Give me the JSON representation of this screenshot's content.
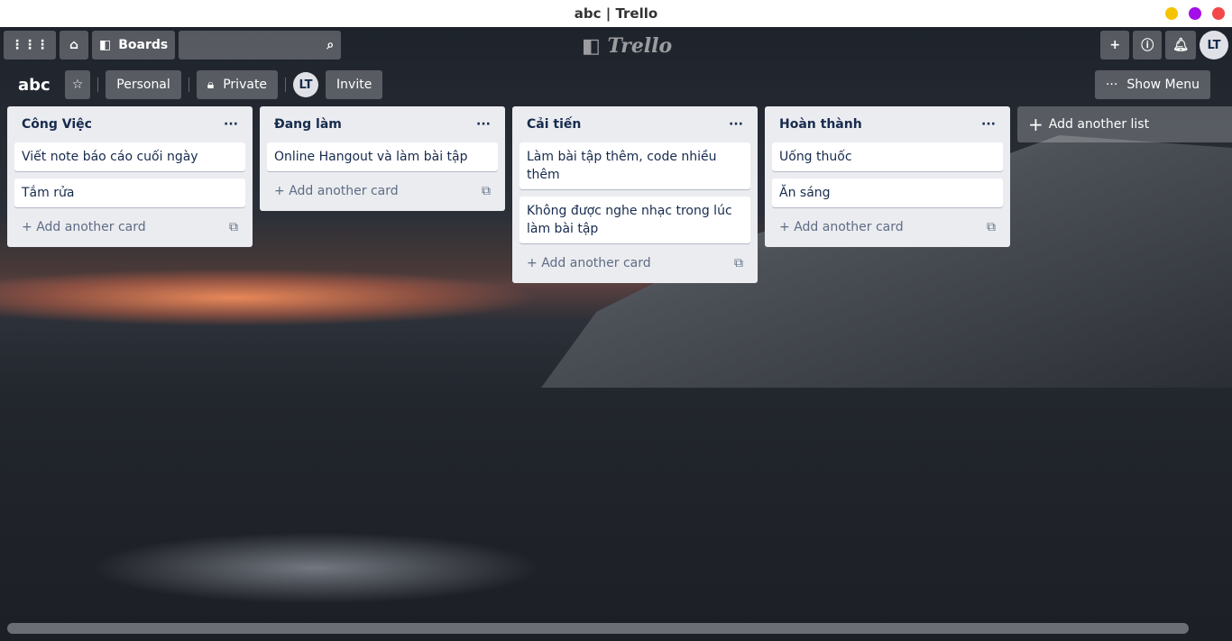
{
  "window": {
    "title": "abc | Trello",
    "controls": [
      "#f5c400",
      "#a40fe8",
      "#f2484a"
    ]
  },
  "nav": {
    "boards": "Boards",
    "search_placeholder": "",
    "logo": "Trello",
    "avatar": "LT"
  },
  "board": {
    "title": "abc",
    "personal": "Personal",
    "private": "Private",
    "member": "LT",
    "invite": "Invite",
    "show_menu": "Show Menu"
  },
  "lists": [
    {
      "title": "Công Việc",
      "cards": [
        "Viết note báo cáo cuối ngày",
        "Tắm rửa"
      ]
    },
    {
      "title": "Đang làm",
      "cards": [
        "Online Hangout và làm bài tập"
      ]
    },
    {
      "title": "Cải tiến",
      "cards": [
        "Làm bài tập thêm, code nhiều thêm",
        "Không được nghe nhạc trong lúc làm bài tập"
      ]
    },
    {
      "title": "Hoàn thành",
      "cards": [
        "Uống thuốc",
        "Ăn sáng"
      ]
    }
  ],
  "add_card": "Add another card",
  "add_list": "Add another list",
  "menu_dots": "···"
}
